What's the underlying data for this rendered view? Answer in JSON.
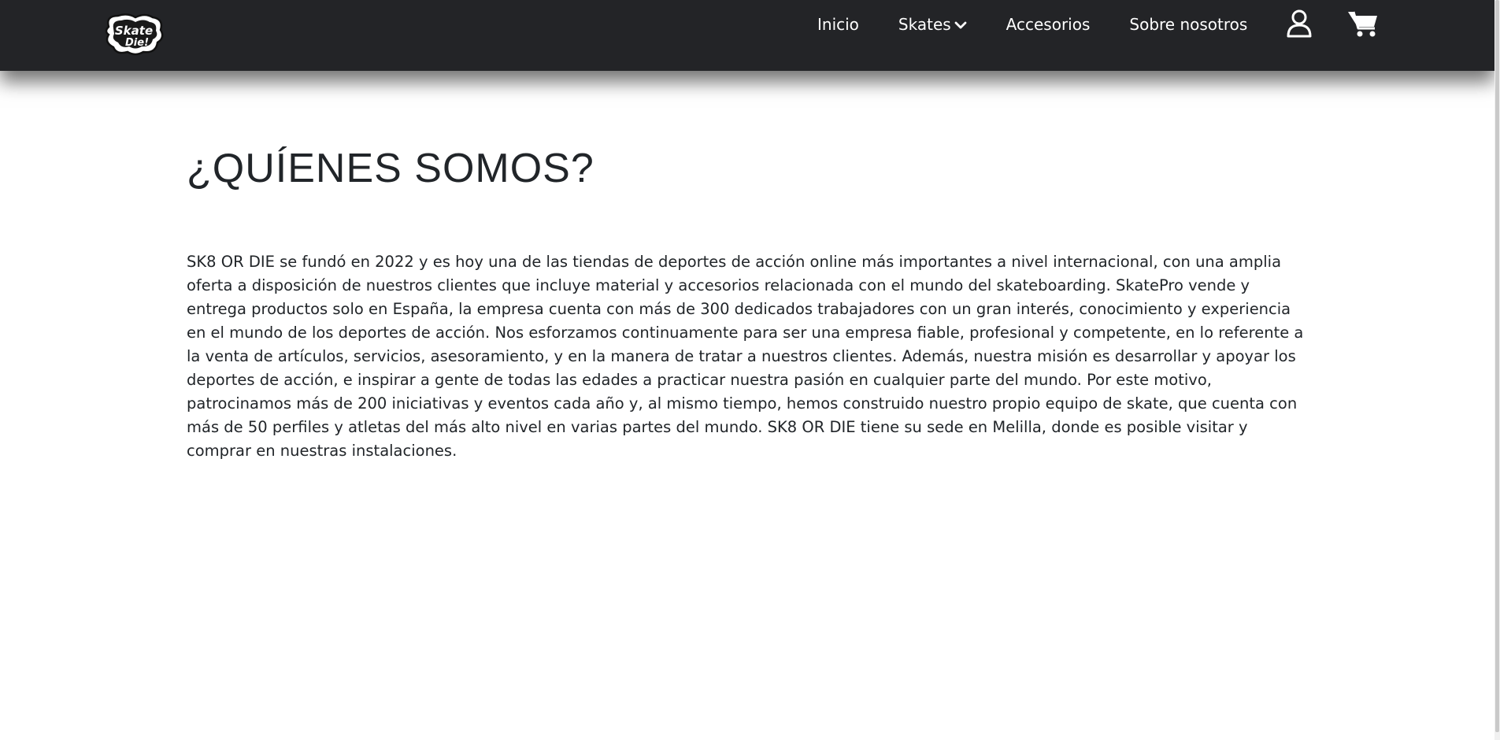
{
  "navbar": {
    "logo_text": "Skate or Die!",
    "links": [
      {
        "label": "Inicio"
      },
      {
        "label": "Skates"
      },
      {
        "label": "Accesorios"
      },
      {
        "label": "Sobre nosotros"
      }
    ],
    "icons": [
      "user-icon",
      "cart-icon"
    ],
    "background_color": "#232427"
  },
  "main": {
    "title": "¿QUÍENES SOMOS?",
    "paragraph": "SK8 OR DIE se fundó en 2022 y es hoy una de las tiendas de deportes de acción online más importantes a nivel internacional, con una amplia oferta a disposición de nuestros clientes que incluye material y accesorios relacionada con el mundo del skateboarding. SkatePro vende y entrega productos solo en España, la empresa cuenta con más de 300 dedicados trabajadores con un gran interés, conocimiento y experiencia en el mundo de los deportes de acción. Nos esforzamos continuamente para ser una empresa fiable, profesional y competente, en lo referente a la venta de artículos, servicios, asesoramiento, y en la manera de tratar a nuestros clientes. Además, nuestra misión es desarrollar y apoyar los deportes de acción, e inspirar a gente de todas las edades a practicar nuestra pasión en cualquier parte del mundo. Por este motivo, patrocinamos más de 200 iniciativas y eventos cada año y, al mismo tiempo, hemos construido nuestro propio equipo de skate, que cuenta con más de 50 perfiles y atletas del más alto nivel en varias partes del mundo. SK8 OR DIE tiene su sede en Melilla, donde es posible visitar y comprar en nuestras instalaciones."
  }
}
